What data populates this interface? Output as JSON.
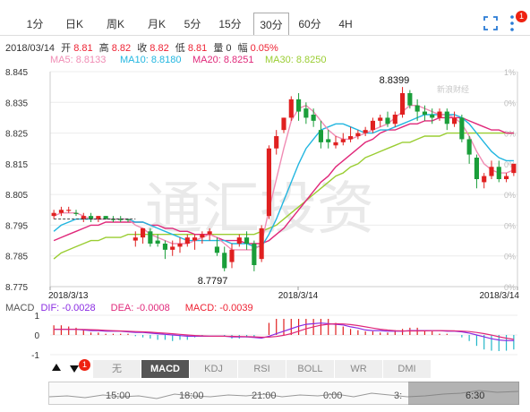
{
  "tabs": [
    "1分",
    "日K",
    "周K",
    "月K",
    "5分",
    "15分",
    "30分",
    "60分",
    "4H"
  ],
  "active_tab": "30分",
  "notification_count": "1",
  "ohlc": {
    "date": "2018/03/14",
    "open_label": "开",
    "open": "8.81",
    "high_label": "高",
    "high": "8.82",
    "close_label": "收",
    "close": "8.82",
    "low_label": "低",
    "low": "8.81",
    "vol_label": "量",
    "vol": "0",
    "chg_label": "幅",
    "chg": "0.05%"
  },
  "ma_legend": [
    {
      "text": "MA5: 8.8133",
      "color": "#f08cb4"
    },
    {
      "text": "MA10: 8.8180",
      "color": "#22b6e0"
    },
    {
      "text": "MA20: 8.8251",
      "color": "#e0287a"
    },
    {
      "text": "MA30: 8.8250",
      "color": "#9acd32"
    }
  ],
  "watermark": "通汇投资",
  "logo_text": "新浪财经",
  "chart_data": {
    "type": "candlestick",
    "y_ticks": [
      "8.845",
      "8.835",
      "8.825",
      "8.815",
      "8.805",
      "8.795",
      "8.785",
      "8.775"
    ],
    "ylim": [
      8.775,
      8.845
    ],
    "pct_ticks": [
      "1%",
      "0%",
      "0%",
      "0%",
      "0%",
      "0%",
      "0%",
      "0%"
    ],
    "x_labels": [
      "2018/3/13",
      "2018/3/14",
      "2018/3/14"
    ],
    "max_annotation": "8.8399",
    "min_annotation": "8.7797",
    "candles": [
      {
        "o": 8.798,
        "h": 8.8,
        "c": 8.799,
        "l": 8.797,
        "up": true
      },
      {
        "o": 8.799,
        "h": 8.801,
        "c": 8.8,
        "l": 8.798,
        "up": true
      },
      {
        "o": 8.8,
        "h": 8.801,
        "c": 8.8,
        "l": 8.799,
        "up": true
      },
      {
        "o": 8.799,
        "h": 8.8,
        "c": 8.799,
        "l": 8.798,
        "up": false
      },
      {
        "o": 8.797,
        "h": 8.799,
        "c": 8.798,
        "l": 8.796,
        "up": true
      },
      {
        "o": 8.798,
        "h": 8.799,
        "c": 8.797,
        "l": 8.796,
        "up": false
      },
      {
        "o": 8.797,
        "h": 8.798,
        "c": 8.798,
        "l": 8.796,
        "up": true
      },
      {
        "o": 8.798,
        "h": 8.798,
        "c": 8.797,
        "l": 8.797,
        "up": false
      },
      {
        "o": 8.797,
        "h": 8.798,
        "c": 8.797,
        "l": 8.796,
        "up": false
      },
      {
        "o": 8.797,
        "h": 8.798,
        "c": 8.797,
        "l": 8.796,
        "up": false
      },
      {
        "o": 8.797,
        "h": 8.797,
        "c": 8.797,
        "l": 8.796,
        "up": false
      },
      {
        "o": 8.79,
        "h": 8.793,
        "c": 8.791,
        "l": 8.788,
        "up": true
      },
      {
        "o": 8.791,
        "h": 8.794,
        "c": 8.794,
        "l": 8.789,
        "up": true
      },
      {
        "o": 8.793,
        "h": 8.794,
        "c": 8.789,
        "l": 8.788,
        "up": false
      },
      {
        "o": 8.79,
        "h": 8.792,
        "c": 8.789,
        "l": 8.788,
        "up": false
      },
      {
        "o": 8.789,
        "h": 8.79,
        "c": 8.787,
        "l": 8.784,
        "up": false
      },
      {
        "o": 8.787,
        "h": 8.79,
        "c": 8.788,
        "l": 8.785,
        "up": true
      },
      {
        "o": 8.788,
        "h": 8.791,
        "c": 8.789,
        "l": 8.786,
        "up": true
      },
      {
        "o": 8.789,
        "h": 8.792,
        "c": 8.791,
        "l": 8.788,
        "up": true
      },
      {
        "o": 8.79,
        "h": 8.792,
        "c": 8.791,
        "l": 8.787,
        "up": true
      },
      {
        "o": 8.791,
        "h": 8.793,
        "c": 8.792,
        "l": 8.789,
        "up": true
      },
      {
        "o": 8.792,
        "h": 8.794,
        "c": 8.793,
        "l": 8.79,
        "up": true
      },
      {
        "o": 8.788,
        "h": 8.791,
        "c": 8.786,
        "l": 8.785,
        "up": false
      },
      {
        "o": 8.786,
        "h": 8.788,
        "c": 8.781,
        "l": 8.78,
        "up": false
      },
      {
        "o": 8.783,
        "h": 8.789,
        "c": 8.787,
        "l": 8.781,
        "up": true
      },
      {
        "o": 8.789,
        "h": 8.792,
        "c": 8.791,
        "l": 8.788,
        "up": true
      },
      {
        "o": 8.791,
        "h": 8.793,
        "c": 8.789,
        "l": 8.787,
        "up": false
      },
      {
        "o": 8.789,
        "h": 8.79,
        "c": 8.782,
        "l": 8.78,
        "up": false
      },
      {
        "o": 8.784,
        "h": 8.795,
        "c": 8.794,
        "l": 8.783,
        "up": true
      },
      {
        "o": 8.798,
        "h": 8.821,
        "c": 8.82,
        "l": 8.797,
        "up": true
      },
      {
        "o": 8.82,
        "h": 8.826,
        "c": 8.824,
        "l": 8.818,
        "up": true
      },
      {
        "o": 8.826,
        "h": 8.83,
        "c": 8.83,
        "l": 8.825,
        "up": true
      },
      {
        "o": 8.83,
        "h": 8.837,
        "c": 8.836,
        "l": 8.829,
        "up": true
      },
      {
        "o": 8.836,
        "h": 8.838,
        "c": 8.832,
        "l": 8.829,
        "up": false
      },
      {
        "o": 8.833,
        "h": 8.835,
        "c": 8.83,
        "l": 8.828,
        "up": false
      },
      {
        "o": 8.831,
        "h": 8.833,
        "c": 8.829,
        "l": 8.827,
        "up": false
      },
      {
        "o": 8.826,
        "h": 8.829,
        "c": 8.822,
        "l": 8.82,
        "up": false
      },
      {
        "o": 8.823,
        "h": 8.826,
        "c": 8.822,
        "l": 8.82,
        "up": false
      },
      {
        "o": 8.821,
        "h": 8.824,
        "c": 8.822,
        "l": 8.82,
        "up": true
      },
      {
        "o": 8.822,
        "h": 8.825,
        "c": 8.823,
        "l": 8.821,
        "up": true
      },
      {
        "o": 8.823,
        "h": 8.827,
        "c": 8.824,
        "l": 8.822,
        "up": true
      },
      {
        "o": 8.824,
        "h": 8.826,
        "c": 8.825,
        "l": 8.823,
        "up": true
      },
      {
        "o": 8.825,
        "h": 8.827,
        "c": 8.826,
        "l": 8.824,
        "up": true
      },
      {
        "o": 8.826,
        "h": 8.83,
        "c": 8.829,
        "l": 8.825,
        "up": true
      },
      {
        "o": 8.829,
        "h": 8.831,
        "c": 8.83,
        "l": 8.827,
        "up": true
      },
      {
        "o": 8.83,
        "h": 8.832,
        "c": 8.828,
        "l": 8.827,
        "up": false
      },
      {
        "o": 8.828,
        "h": 8.832,
        "c": 8.831,
        "l": 8.827,
        "up": true
      },
      {
        "o": 8.831,
        "h": 8.84,
        "c": 8.838,
        "l": 8.83,
        "up": true
      },
      {
        "o": 8.838,
        "h": 8.839,
        "c": 8.834,
        "l": 8.833,
        "up": false
      },
      {
        "o": 8.834,
        "h": 8.836,
        "c": 8.832,
        "l": 8.829,
        "up": false
      },
      {
        "o": 8.832,
        "h": 8.834,
        "c": 8.831,
        "l": 8.829,
        "up": false
      },
      {
        "o": 8.831,
        "h": 8.833,
        "c": 8.83,
        "l": 8.828,
        "up": false
      },
      {
        "o": 8.83,
        "h": 8.833,
        "c": 8.832,
        "l": 8.829,
        "up": true
      },
      {
        "o": 8.832,
        "h": 8.833,
        "c": 8.828,
        "l": 8.826,
        "up": false
      },
      {
        "o": 8.828,
        "h": 8.832,
        "c": 8.83,
        "l": 8.827,
        "up": true
      },
      {
        "o": 8.83,
        "h": 8.831,
        "c": 8.823,
        "l": 8.822,
        "up": false
      },
      {
        "o": 8.823,
        "h": 8.824,
        "c": 8.818,
        "l": 8.815,
        "up": false
      },
      {
        "o": 8.817,
        "h": 8.818,
        "c": 8.81,
        "l": 8.807,
        "up": false
      },
      {
        "o": 8.809,
        "h": 8.812,
        "c": 8.811,
        "l": 8.807,
        "up": true
      },
      {
        "o": 8.811,
        "h": 8.816,
        "c": 8.814,
        "l": 8.81,
        "up": true
      },
      {
        "o": 8.814,
        "h": 8.816,
        "c": 8.81,
        "l": 8.809,
        "up": false
      },
      {
        "o": 8.81,
        "h": 8.812,
        "c": 8.811,
        "l": 8.809,
        "up": true
      },
      {
        "o": 8.812,
        "h": 8.815,
        "c": 8.815,
        "l": 8.811,
        "up": true
      }
    ],
    "ma5": [
      8.798,
      8.799,
      8.799,
      8.799,
      8.798,
      8.797,
      8.797,
      8.797,
      8.797,
      8.797,
      8.797,
      8.795,
      8.794,
      8.792,
      8.791,
      8.79,
      8.789,
      8.789,
      8.789,
      8.79,
      8.791,
      8.792,
      8.791,
      8.789,
      8.787,
      8.787,
      8.787,
      8.787,
      8.789,
      8.8,
      8.81,
      8.82,
      8.829,
      8.833,
      8.834,
      8.832,
      8.829,
      8.826,
      8.824,
      8.823,
      8.823,
      8.824,
      8.825,
      8.826,
      8.827,
      8.828,
      8.83,
      8.832,
      8.834,
      8.834,
      8.833,
      8.832,
      8.831,
      8.831,
      8.83,
      8.828,
      8.824,
      8.819,
      8.815,
      8.813,
      8.812,
      8.812,
      8.813
    ],
    "ma10": [
      8.793,
      8.795,
      8.796,
      8.797,
      8.797,
      8.797,
      8.797,
      8.797,
      8.797,
      8.797,
      8.797,
      8.796,
      8.796,
      8.795,
      8.794,
      8.793,
      8.792,
      8.791,
      8.79,
      8.79,
      8.79,
      8.79,
      8.79,
      8.79,
      8.789,
      8.789,
      8.789,
      8.788,
      8.788,
      8.792,
      8.797,
      8.803,
      8.809,
      8.815,
      8.82,
      8.823,
      8.826,
      8.827,
      8.828,
      8.828,
      8.827,
      8.826,
      8.825,
      8.825,
      8.826,
      8.826,
      8.827,
      8.828,
      8.829,
      8.83,
      8.831,
      8.831,
      8.831,
      8.831,
      8.831,
      8.83,
      8.828,
      8.825,
      8.822,
      8.819,
      8.817,
      8.816,
      8.816
    ],
    "ma20": [
      8.79,
      8.791,
      8.792,
      8.793,
      8.794,
      8.795,
      8.795,
      8.796,
      8.796,
      8.796,
      8.796,
      8.796,
      8.796,
      8.795,
      8.795,
      8.794,
      8.794,
      8.793,
      8.793,
      8.792,
      8.792,
      8.792,
      8.791,
      8.79,
      8.79,
      8.79,
      8.789,
      8.789,
      8.789,
      8.79,
      8.792,
      8.794,
      8.797,
      8.8,
      8.803,
      8.806,
      8.809,
      8.811,
      8.814,
      8.816,
      8.818,
      8.82,
      8.822,
      8.823,
      8.825,
      8.826,
      8.826,
      8.827,
      8.828,
      8.828,
      8.829,
      8.829,
      8.83,
      8.83,
      8.83,
      8.83,
      8.829,
      8.828,
      8.827,
      8.826,
      8.826,
      8.825,
      8.825
    ],
    "ma30": [
      8.784,
      8.786,
      8.787,
      8.788,
      8.789,
      8.79,
      8.79,
      8.791,
      8.791,
      8.791,
      8.792,
      8.792,
      8.792,
      8.792,
      8.792,
      8.792,
      8.792,
      8.792,
      8.792,
      8.792,
      8.792,
      8.792,
      8.792,
      8.792,
      8.792,
      8.792,
      8.792,
      8.792,
      8.793,
      8.794,
      8.795,
      8.797,
      8.799,
      8.801,
      8.803,
      8.805,
      8.807,
      8.809,
      8.811,
      8.812,
      8.814,
      8.815,
      8.817,
      8.818,
      8.819,
      8.82,
      8.821,
      8.822,
      8.822,
      8.823,
      8.824,
      8.824,
      8.824,
      8.825,
      8.825,
      8.825,
      8.825,
      8.825,
      8.825,
      8.825,
      8.825,
      8.825,
      8.825
    ]
  },
  "macd": {
    "label": "MACD",
    "dif": "DIF: -0.0028",
    "dea": "DEA: -0.0008",
    "macd": "MACD: -0.0039",
    "dif_color": "#8a2be2",
    "dea_color": "#e0287a",
    "macd_color": "#e23",
    "y_ticks": [
      "1",
      "0",
      "-1"
    ]
  },
  "indicator_tabs": [
    "无",
    "MACD",
    "KDJ",
    "RSI",
    "BOLL",
    "WR",
    "DMI"
  ],
  "active_indicator": "MACD",
  "nav_labels": [
    "15:00",
    "18:00",
    "21:00",
    "0:00",
    "3:",
    "6:30"
  ]
}
